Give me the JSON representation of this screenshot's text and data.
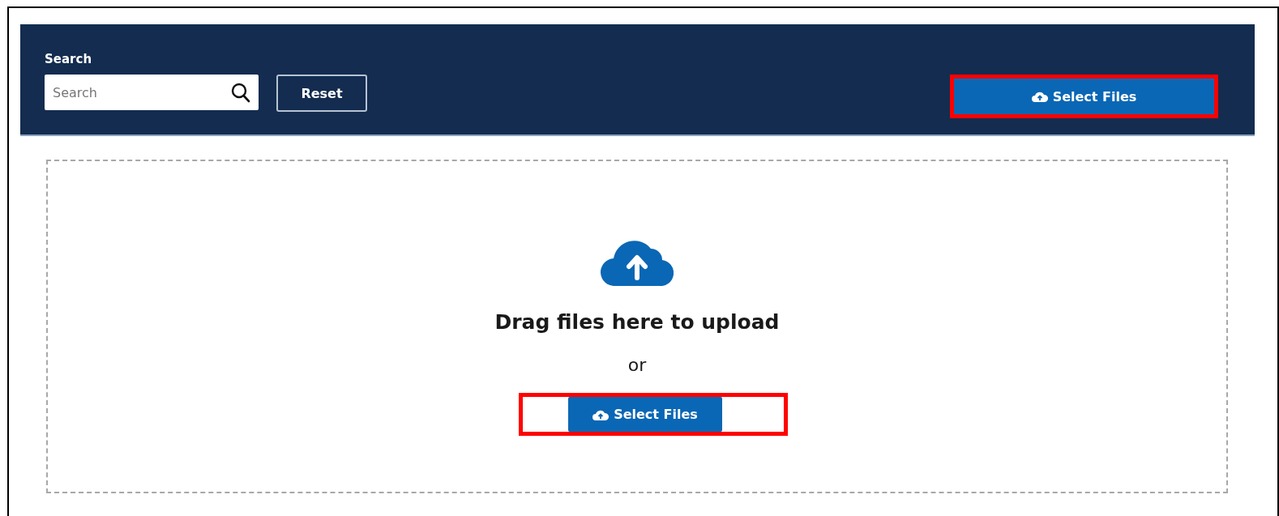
{
  "toolbar": {
    "search_label": "Search",
    "search": {
      "placeholder": "Search"
    },
    "reset_button": "Reset",
    "select_button": {
      "label": "Select Files",
      "highlighted": true
    }
  },
  "dropzone": {
    "title": "Drag files here to upload",
    "separator": "or",
    "select_button": {
      "label": "Select Files",
      "highlighted": true
    }
  }
}
